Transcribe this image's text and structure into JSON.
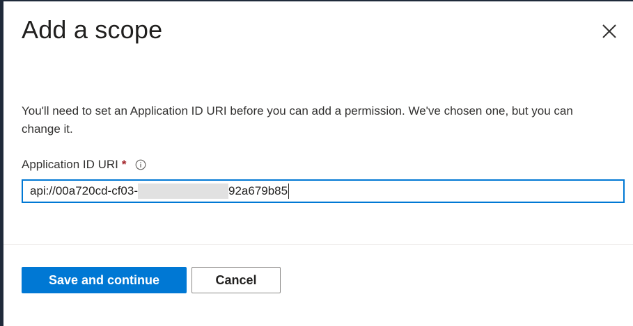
{
  "dialog": {
    "title": "Add a scope",
    "description": "You'll need to set an Application ID URI before you can add a permission. We've chosen one, but you can change it."
  },
  "field": {
    "label": "Application ID URI",
    "required_marker": "*",
    "value_prefix": "api://00a720cd-cf03-",
    "value_suffix": "92a679b85"
  },
  "actions": {
    "save_label": "Save and continue",
    "cancel_label": "Cancel"
  },
  "colors": {
    "primary": "#0078d4",
    "required": "#a4262c"
  },
  "icons": {
    "close": "close-icon",
    "info": "info-icon"
  }
}
